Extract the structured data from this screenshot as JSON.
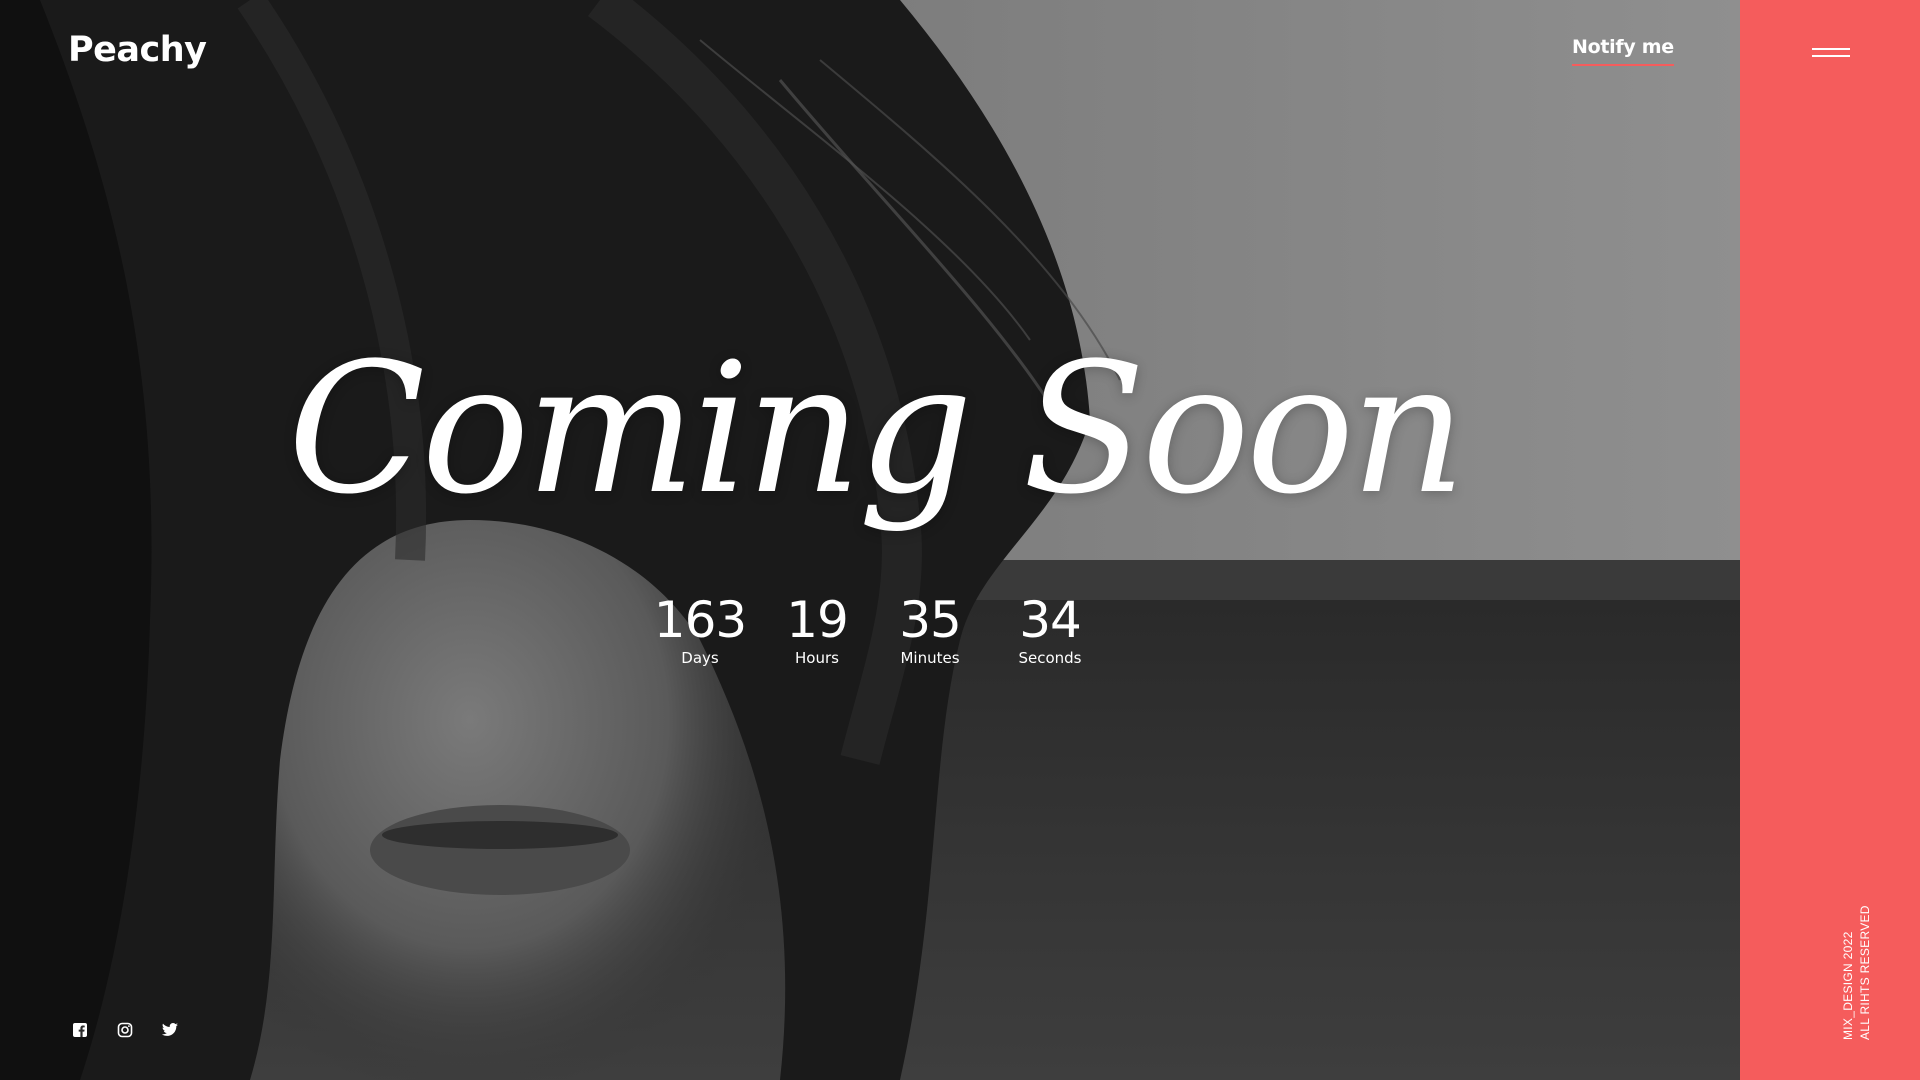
{
  "brand": {
    "name": "Peachy"
  },
  "header": {
    "notify_label": "Notify me"
  },
  "hero": {
    "title": "Coming Soon"
  },
  "countdown": {
    "days": {
      "value": "163",
      "label": "Days"
    },
    "hours": {
      "value": "19",
      "label": "Hours"
    },
    "minutes": {
      "value": "35",
      "label": "Minutes"
    },
    "seconds": {
      "value": "34",
      "label": "Seconds"
    }
  },
  "side_panel": {
    "copyright_line1": "MIX_DESIGN 2022",
    "copyright_line2": "ALL RIHTS RESERVED"
  },
  "social": {
    "icons": [
      "facebook-icon",
      "instagram-icon",
      "twitter-icon"
    ]
  },
  "colors": {
    "accent": "#f55c5c",
    "text": "#ffffff"
  }
}
